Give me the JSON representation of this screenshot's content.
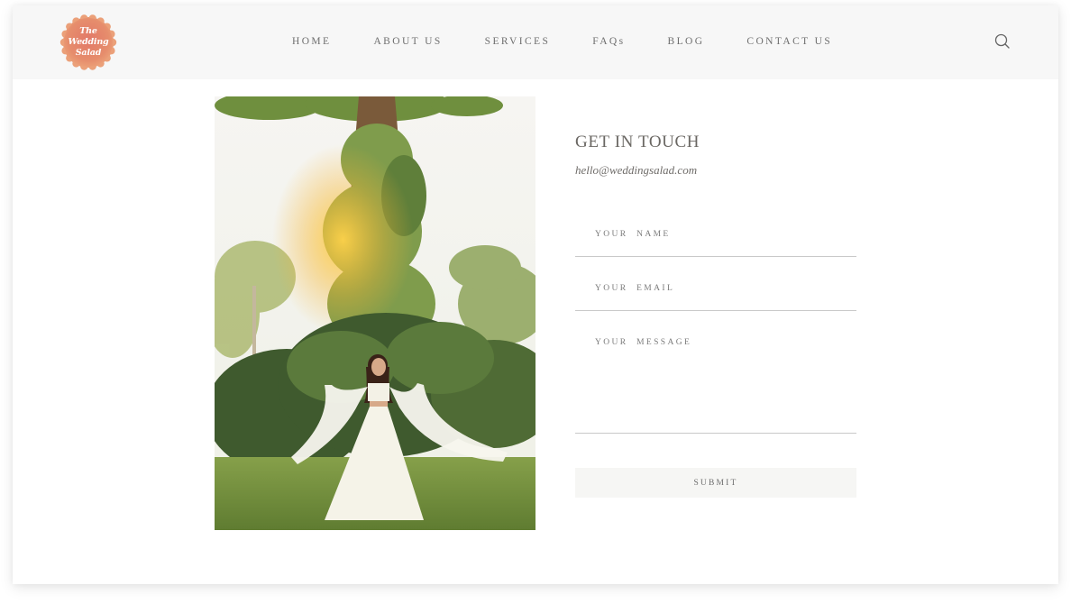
{
  "brand": {
    "logo_lines": [
      "The",
      "Wedding",
      "Salad"
    ],
    "logo_color": "#e0876e"
  },
  "nav": {
    "items": [
      {
        "label": "HOME"
      },
      {
        "label": "ABOUT US"
      },
      {
        "label": "SERVICES"
      },
      {
        "label": "FAQs"
      },
      {
        "label": "BLOG"
      },
      {
        "label": "CONTACT US"
      }
    ],
    "search_icon": "search-icon"
  },
  "photo": {
    "description": "Bride in white lehenga dancing in front of a vine-covered tree"
  },
  "contact": {
    "title": "GET IN TOUCH",
    "email": "hello@weddingsalad.com",
    "form": {
      "name_placeholder": "YOUR  NAME",
      "name_value": "",
      "email_placeholder": "YOUR  EMAIL",
      "email_value": "",
      "message_placeholder": "YOUR  MESSAGE",
      "message_value": "",
      "submit_label": "SUBMIT"
    }
  }
}
